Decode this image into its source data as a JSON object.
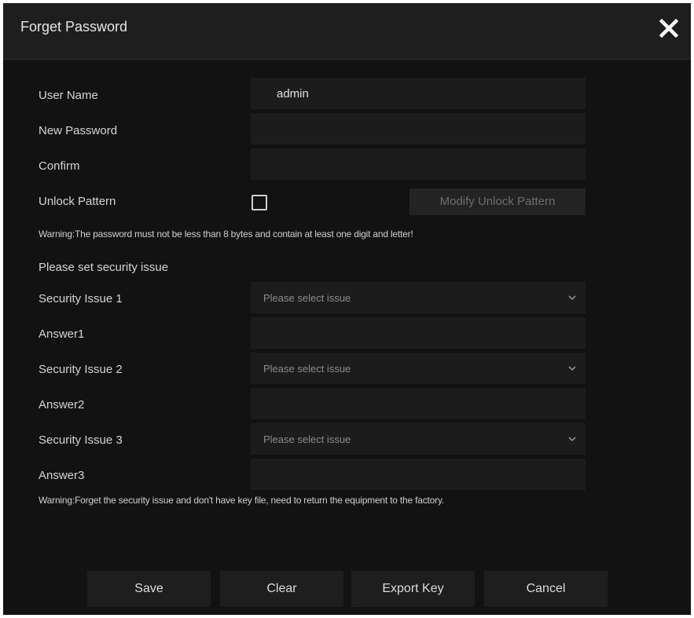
{
  "dialog": {
    "title": "Forget Password"
  },
  "form": {
    "username_label": "User Name",
    "username_value": "admin",
    "new_password_label": "New Password",
    "new_password_value": "",
    "confirm_label": "Confirm",
    "confirm_value": "",
    "unlock_pattern_label": "Unlock Pattern",
    "unlock_pattern_checked": false,
    "modify_pattern_label": "Modify Unlock Pattern",
    "password_warning": "Warning:The password must not be less than 8 bytes and contain at least one digit and letter!"
  },
  "security": {
    "section_title": "Please set security issue",
    "issues": [
      {
        "issue_label": "Security Issue 1",
        "selected": "Please select issue",
        "answer_label": "Answer1",
        "answer_value": ""
      },
      {
        "issue_label": "Security Issue 2",
        "selected": "Please select issue",
        "answer_label": "Answer2",
        "answer_value": ""
      },
      {
        "issue_label": "Security Issue 3",
        "selected": "Please select issue",
        "answer_label": "Answer3",
        "answer_value": ""
      }
    ],
    "warning": "Warning:Forget the security issue and don't have key file, need to return the equipment to the factory."
  },
  "buttons": {
    "save": "Save",
    "clear": "Clear",
    "export_key": "Export Key",
    "cancel": "Cancel"
  },
  "icons": {
    "close": "close-icon",
    "dropdown": "chevron-down-icon"
  },
  "colors": {
    "background": "#121212",
    "field": "#1c1c1c",
    "text": "#d4d4d4"
  }
}
